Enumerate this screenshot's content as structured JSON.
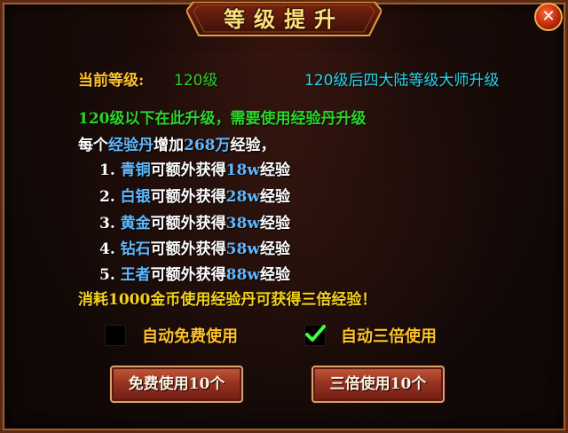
{
  "title": "等级提升",
  "close_label": "✕",
  "current_level": {
    "label": "当前等级:",
    "value": "120级"
  },
  "master_note": "120级后四大陆等级大师升级",
  "line1": "120级以下在此升级，需要使用经验丹升级",
  "line2": {
    "p1": "每个",
    "item": "经验丹",
    "p2": "增加",
    "amount": "268万",
    "p3": "经验，"
  },
  "tiers": [
    {
      "num": "1.",
      "name": "青铜",
      "mid": "可额外获得",
      "bonus": "18w",
      "end": "经验"
    },
    {
      "num": "2.",
      "name": "白银",
      "mid": "可额外获得",
      "bonus": "28w",
      "end": "经验"
    },
    {
      "num": "3.",
      "name": "黄金",
      "mid": "可额外获得",
      "bonus": "38w",
      "end": "经验"
    },
    {
      "num": "4.",
      "name": "钻石",
      "mid": "可额外获得",
      "bonus": "58w",
      "end": "经验"
    },
    {
      "num": "5.",
      "name": "王者",
      "mid": "可额外获得",
      "bonus": "88w",
      "end": "经验"
    }
  ],
  "triple_note": "消耗1000金币使用经验丹可获得三倍经验！",
  "options": {
    "auto_free": {
      "label": "自动免费使用",
      "checked": false
    },
    "auto_triple": {
      "label": "自动三倍使用",
      "checked": true
    }
  },
  "buttons": {
    "free10": "免费使用10个",
    "triple10": "三倍使用10个"
  },
  "colors": {
    "gold": "#ffc02a",
    "green": "#2bd42b",
    "cyan": "#25d7ee",
    "blue": "#5fb8ff",
    "yellow": "#f4d21a"
  }
}
